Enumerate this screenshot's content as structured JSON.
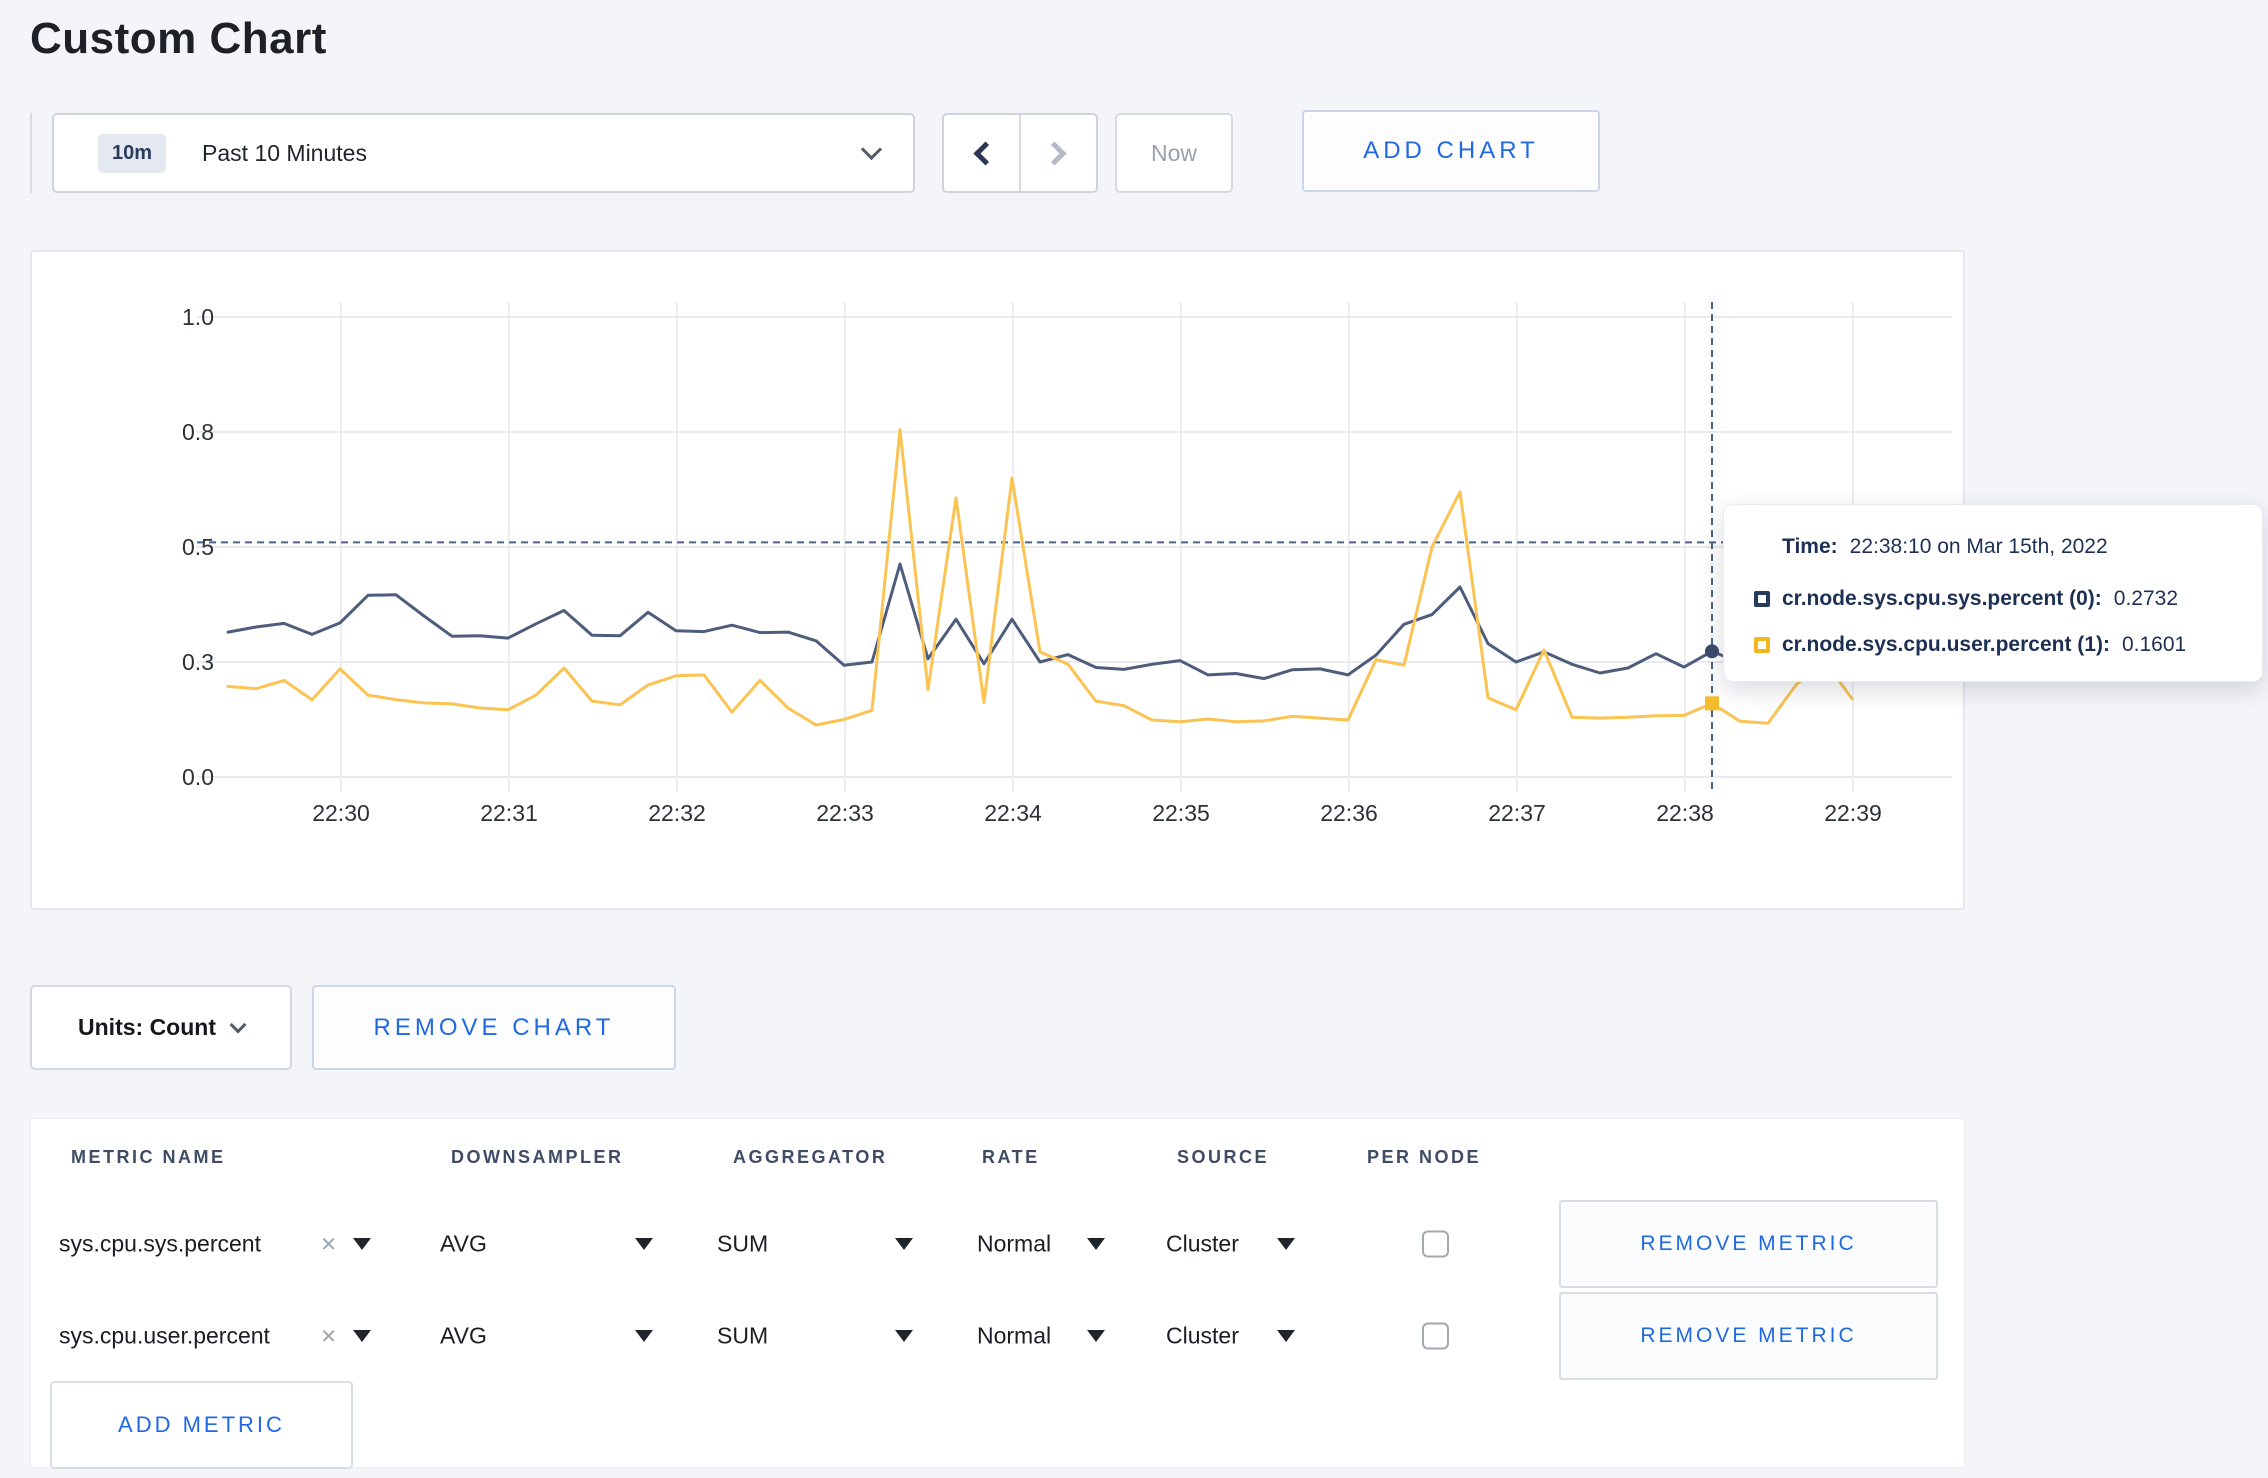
{
  "page": {
    "title": "Custom Chart"
  },
  "toolbar": {
    "time_selector": {
      "badge": "10m",
      "label": "Past 10 Minutes"
    },
    "now_label": "Now",
    "add_chart_label": "ADD CHART"
  },
  "chart": {
    "y_ticks": [
      "1.0",
      "0.8",
      "0.5",
      "0.3",
      "0.0"
    ],
    "x_ticks": [
      "22:30",
      "22:31",
      "22:32",
      "22:33",
      "22:34",
      "22:35",
      "22:36",
      "22:37",
      "22:38",
      "22:39"
    ],
    "grid_color": "#e9ebee",
    "grid_color_v": "#edeef1",
    "crosshair": {
      "time": "22:38:10",
      "x_index": 53,
      "y_value": 0.51,
      "color": "#4a6284"
    },
    "tooltip": {
      "time_label": "Time:",
      "time_value": "22:38:10 on Mar 15th, 2022",
      "rows": [
        {
          "label": "cr.node.sys.cpu.sys.percent (0):",
          "value": "0.2732",
          "swatch_color": "#263a5e"
        },
        {
          "label": "cr.node.sys.cpu.user.percent (1):",
          "value": "0.1601",
          "swatch_color": "#f1b71f"
        }
      ]
    }
  },
  "chart_data": {
    "type": "line",
    "title": "",
    "xlabel": "time",
    "ylabel": "",
    "ylim": [
      0,
      1
    ],
    "y_tick_labels": [
      "0.0",
      "0.3",
      "0.5",
      "0.8",
      "1.0"
    ],
    "grid": true,
    "legend_position": "none",
    "x": [
      "22:29:20",
      "22:29:30",
      "22:29:40",
      "22:29:50",
      "22:30:00",
      "22:30:10",
      "22:30:20",
      "22:30:30",
      "22:30:40",
      "22:30:50",
      "22:31:00",
      "22:31:10",
      "22:31:20",
      "22:31:30",
      "22:31:40",
      "22:31:50",
      "22:32:00",
      "22:32:10",
      "22:32:20",
      "22:32:30",
      "22:32:40",
      "22:32:50",
      "22:33:00",
      "22:33:10",
      "22:33:20",
      "22:33:30",
      "22:33:40",
      "22:33:50",
      "22:34:00",
      "22:34:10",
      "22:34:20",
      "22:34:30",
      "22:34:40",
      "22:34:50",
      "22:35:00",
      "22:35:10",
      "22:35:20",
      "22:35:30",
      "22:35:40",
      "22:35:50",
      "22:36:00",
      "22:36:10",
      "22:36:20",
      "22:36:30",
      "22:36:40",
      "22:36:50",
      "22:37:00",
      "22:37:10",
      "22:37:20",
      "22:37:30",
      "22:37:40",
      "22:37:50",
      "22:38:00",
      "22:38:10",
      "22:38:20",
      "22:38:30",
      "22:38:40",
      "22:38:50",
      "22:39:00"
    ],
    "series": [
      {
        "name": "cr.node.sys.cpu.sys.percent",
        "color": "#4e5d7c",
        "dot_color": "#3a4a6a",
        "values": [
          0.315,
          0.326,
          0.334,
          0.31,
          0.335,
          0.395,
          0.396,
          0.35,
          0.306,
          0.307,
          0.302,
          0.333,
          0.362,
          0.308,
          0.307,
          0.358,
          0.318,
          0.316,
          0.33,
          0.314,
          0.315,
          0.296,
          0.243,
          0.25,
          0.463,
          0.257,
          0.343,
          0.246,
          0.343,
          0.25,
          0.266,
          0.238,
          0.234,
          0.245,
          0.253,
          0.222,
          0.225,
          0.214,
          0.233,
          0.235,
          0.222,
          0.265,
          0.332,
          0.353,
          0.413,
          0.29,
          0.25,
          0.272,
          0.245,
          0.226,
          0.237,
          0.268,
          0.239,
          0.2732,
          0.248,
          0.252,
          0.255,
          0.26,
          0.265
        ]
      },
      {
        "name": "cr.node.sys.cpu.user.percent",
        "color": "#fac352",
        "dot_color": "#f7bb2e",
        "values": [
          0.197,
          0.192,
          0.21,
          0.168,
          0.235,
          0.178,
          0.168,
          0.161,
          0.159,
          0.15,
          0.146,
          0.178,
          0.237,
          0.165,
          0.157,
          0.2,
          0.22,
          0.222,
          0.141,
          0.21,
          0.15,
          0.113,
          0.125,
          0.145,
          0.755,
          0.19,
          0.607,
          0.162,
          0.65,
          0.272,
          0.245,
          0.165,
          0.155,
          0.124,
          0.12,
          0.126,
          0.12,
          0.122,
          0.132,
          0.128,
          0.124,
          0.255,
          0.243,
          0.5,
          0.62,
          0.172,
          0.146,
          0.276,
          0.13,
          0.128,
          0.13,
          0.133,
          0.134,
          0.1601,
          0.121,
          0.117,
          0.2,
          0.255,
          0.17
        ]
      }
    ]
  },
  "units_bar": {
    "units_label": "Units: Count",
    "remove_chart_label": "REMOVE CHART"
  },
  "metrics_table": {
    "headers": [
      "METRIC NAME",
      "DOWNSAMPLER",
      "AGGREGATOR",
      "RATE",
      "SOURCE",
      "PER NODE"
    ],
    "rows": [
      {
        "metric": "sys.cpu.sys.percent",
        "downsampler": "AVG",
        "aggregator": "SUM",
        "rate": "Normal",
        "source": "Cluster",
        "per_node_checked": false,
        "remove_label": "REMOVE METRIC"
      },
      {
        "metric": "sys.cpu.user.percent",
        "downsampler": "AVG",
        "aggregator": "SUM",
        "rate": "Normal",
        "source": "Cluster",
        "per_node_checked": false,
        "remove_label": "REMOVE METRIC"
      }
    ],
    "add_metric_label": "ADD METRIC"
  },
  "icons": {
    "clear": "×"
  }
}
